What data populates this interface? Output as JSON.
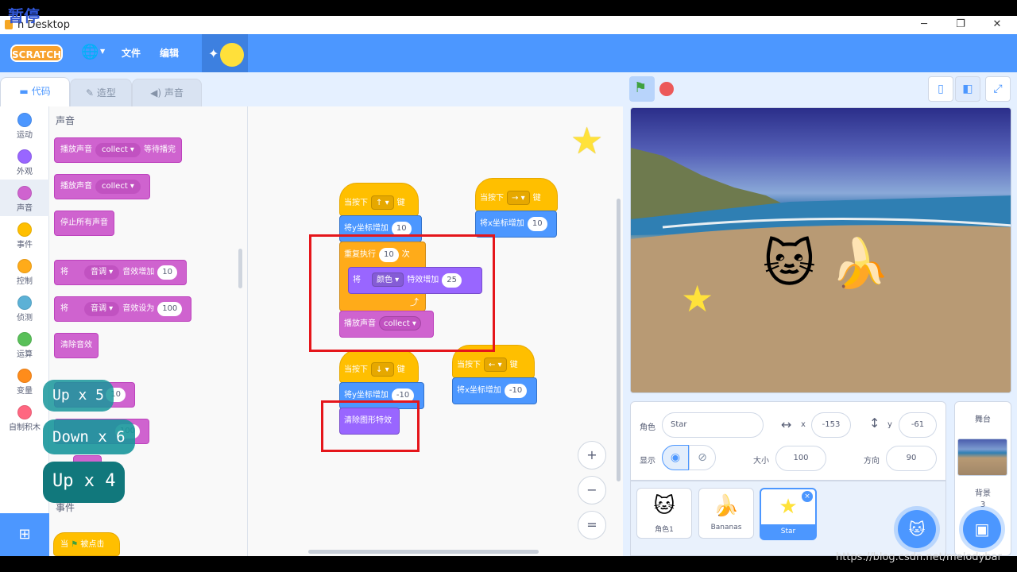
{
  "window": {
    "overlay_label": "暂停",
    "title": "h Desktop",
    "controls": [
      "─",
      "❐",
      "✕"
    ]
  },
  "menu": {
    "logo": "SCRATCH",
    "file": "文件",
    "edit": "编辑"
  },
  "tabs": [
    {
      "label": "代码"
    },
    {
      "label": "造型"
    },
    {
      "label": "声音"
    }
  ],
  "categories": [
    {
      "label": "运动",
      "color": "#4c97ff"
    },
    {
      "label": "外观",
      "color": "#9966ff"
    },
    {
      "label": "声音",
      "color": "#cf63cf"
    },
    {
      "label": "事件",
      "color": "#ffbf00"
    },
    {
      "label": "控制",
      "color": "#ffab19"
    },
    {
      "label": "侦测",
      "color": "#5cb1d6"
    },
    {
      "label": "运算",
      "color": "#59c059"
    },
    {
      "label": "变量",
      "color": "#ff8c1a"
    },
    {
      "label": "自制积木",
      "color": "#ff6680"
    }
  ],
  "palette": {
    "heading": "声音",
    "play_until_done": {
      "prefix": "播放声音",
      "sound": "collect",
      "suffix": "等待播完"
    },
    "play": {
      "prefix": "播放声音",
      "sound": "collect"
    },
    "stop_all": "停止所有声音",
    "change_effect": {
      "prefix": "将",
      "effect": "音调",
      "suffix": "音效增加",
      "value": "10"
    },
    "set_effect": {
      "prefix": "将",
      "effect": "音调",
      "suffix": "音效设为",
      "value": "100"
    },
    "clear_effects": "清除音效",
    "partial_value1": "10",
    "partial_value2": "100",
    "events_heading": "事件",
    "when_flag": {
      "prefix": "当",
      "suffix": "被点击"
    }
  },
  "key_overlay": [
    "Up  x  5",
    "Down  x  6",
    "Up  x  4"
  ],
  "script": {
    "up": {
      "when": "当按下",
      "key": "↑",
      "suffix": "键",
      "change": "将y坐标增加",
      "value": "10"
    },
    "repeat": {
      "label": "重复执行",
      "times": "10",
      "suffix": "次"
    },
    "effect": {
      "prefix": "将",
      "effect": "颜色",
      "suffix": "特效增加",
      "value": "25"
    },
    "play": {
      "label": "播放声音",
      "sound": "collect"
    },
    "right": {
      "when": "当按下",
      "key": "→",
      "suffix": "键",
      "change": "将x坐标增加",
      "value": "10"
    },
    "down": {
      "when": "当按下",
      "key": "↓",
      "suffix": "键",
      "change": "将y坐标增加",
      "value": "-10"
    },
    "clear": "清除图形特效",
    "left": {
      "when": "当按下",
      "key": "←",
      "suffix": "键",
      "change": "将x坐标增加",
      "value": "-10"
    }
  },
  "zoom": {
    "in": "+",
    "out": "−",
    "reset": "="
  },
  "sprite_info": {
    "sprite_label": "角色",
    "sprite_name": "Star",
    "x_label": "x",
    "x": "-153",
    "y_label": "y",
    "y": "-61",
    "show_label": "显示",
    "size_label": "大小",
    "size": "100",
    "direction_label": "方向",
    "direction": "90"
  },
  "sprites": [
    {
      "name": "角色1",
      "icon": "cat-icon"
    },
    {
      "name": "Bananas",
      "icon": "bananas-icon"
    },
    {
      "name": "Star",
      "icon": "star-icon"
    }
  ],
  "stage_panel": {
    "title": "舞台",
    "backdrop_label": "背景",
    "backdrop_count": "3"
  },
  "watermark": "https://blog.csdn.net/melodybar"
}
